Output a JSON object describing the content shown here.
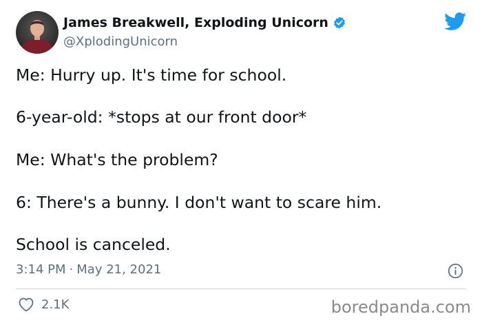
{
  "author": {
    "display_name": "James Breakwell, Exploding Unicorn",
    "handle": "@XplodingUnicorn",
    "verified": true
  },
  "tweet": {
    "lines": [
      "Me: Hurry up. It's time for school.",
      "6-year-old: *stops at our front door*",
      "Me: What's the problem?",
      "6: There's a bunny. I don't want to scare him.",
      "School is canceled."
    ],
    "time": "3:14 PM",
    "separator": "·",
    "date": "May 21, 2021"
  },
  "engagement": {
    "likes": "2.1K"
  },
  "watermark": "boredpanda.com",
  "colors": {
    "twitter_blue": "#1d9bf0",
    "text": "#0f1419",
    "secondary": "#5b7083",
    "divider": "#cfd9de"
  },
  "icons": {
    "platform": "twitter-bird-icon",
    "verified": "verified-badge-icon",
    "info": "info-icon",
    "like": "heart-icon"
  }
}
